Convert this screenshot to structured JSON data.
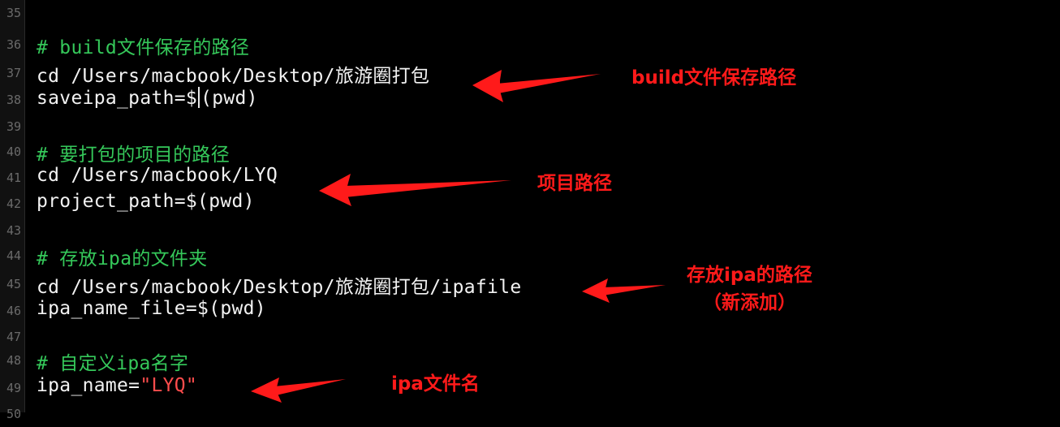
{
  "editor": {
    "lines": [
      {
        "num": "35",
        "text": "",
        "type": "blank"
      },
      {
        "num": "36",
        "text": "# build文件保存的路径",
        "type": "comment"
      },
      {
        "num": "37",
        "text": "cd /Users/macbook/Desktop/旅游圈打包",
        "type": "code"
      },
      {
        "num": "38",
        "pre": "saveipa_path=$",
        "post": "(pwd)",
        "type": "caret"
      },
      {
        "num": "39",
        "text": "",
        "type": "blank"
      },
      {
        "num": "40",
        "text": "# 要打包的项目的路径",
        "type": "comment"
      },
      {
        "num": "41",
        "text": "cd /Users/macbook/LYQ",
        "type": "code"
      },
      {
        "num": "42",
        "text": "project_path=$(pwd)",
        "type": "code"
      },
      {
        "num": "43",
        "text": "",
        "type": "blank"
      },
      {
        "num": "44",
        "text": "# 存放ipa的文件夹",
        "type": "comment"
      },
      {
        "num": "45",
        "text": "cd /Users/macbook/Desktop/旅游圈打包/ipafile",
        "type": "code"
      },
      {
        "num": "46",
        "text": "ipa_name_file=$(pwd)",
        "type": "code"
      },
      {
        "num": "47",
        "text": "",
        "type": "blank"
      },
      {
        "num": "48",
        "text": "# 自定义ipa名字",
        "type": "comment"
      },
      {
        "num": "49",
        "pre": "ipa_name=",
        "str": "\"LYQ\"",
        "type": "string"
      },
      {
        "num": "50",
        "text": "",
        "type": "blank"
      }
    ]
  },
  "annotations": {
    "build_path": "build文件保存路径",
    "project_path": "项目路径",
    "ipa_path_line1": "存放ipa的路径",
    "ipa_path_line2": "（新添加）",
    "ipa_filename": "ipa文件名"
  },
  "colors": {
    "background": "#000000",
    "comment": "#35c85a",
    "string": "#ff4d4d",
    "annotation": "#ff1a1a",
    "line_number": "#6a6a6a"
  }
}
